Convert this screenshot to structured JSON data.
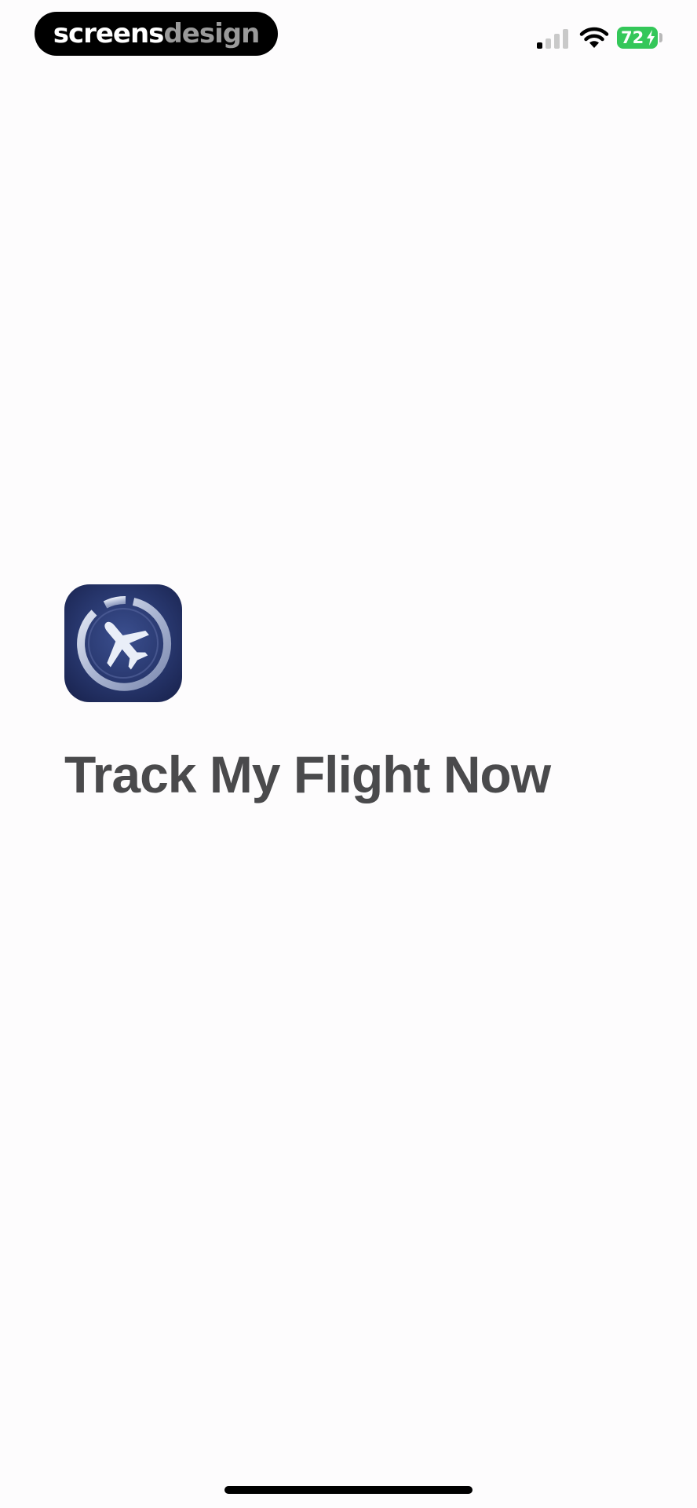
{
  "status_bar": {
    "watermark": {
      "part1": "screens",
      "part2": "design"
    },
    "signal": {
      "icon": "cellular-signal-icon",
      "bars_total": 4,
      "bars_active": 1
    },
    "wifi": {
      "icon": "wifi-icon"
    },
    "battery": {
      "level": "72",
      "charging": true,
      "color": "#34c759"
    }
  },
  "app": {
    "icon": "airplane-app-icon",
    "title": "Track My Flight Now",
    "icon_colors": {
      "background": "#27366c",
      "ring": "#c9d2e8",
      "plane": "#e9eef8"
    }
  }
}
